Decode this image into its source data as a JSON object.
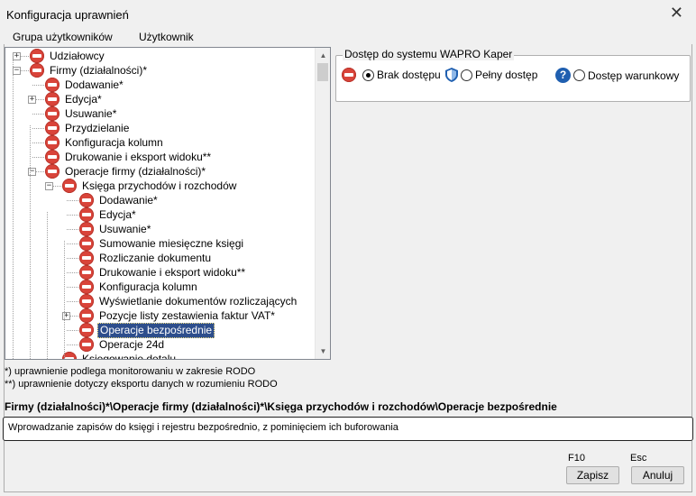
{
  "window": {
    "title": "Konfiguracja uprawnień",
    "close_glyph": "✕"
  },
  "tabs": [
    "Grupa użytkowników",
    "Użytkownik"
  ],
  "tree": {
    "items": [
      {
        "label": "Udziałowcy",
        "level": 0,
        "expander": "plus"
      },
      {
        "label": "Firmy (działalności)*",
        "level": 0,
        "expander": "minus"
      },
      {
        "label": "Dodawanie*",
        "level": 1
      },
      {
        "label": "Edycja*",
        "level": 1,
        "expander": "plus"
      },
      {
        "label": "Usuwanie*",
        "level": 1
      },
      {
        "label": "Przydzielanie",
        "level": 1
      },
      {
        "label": "Konfiguracja kolumn",
        "level": 1
      },
      {
        "label": "Drukowanie i eksport widoku**",
        "level": 1
      },
      {
        "label": "Operacje firmy (działalności)*",
        "level": 1,
        "expander": "minus"
      },
      {
        "label": "Księga przychodów i rozchodów",
        "level": 2,
        "expander": "minus"
      },
      {
        "label": "Dodawanie*",
        "level": 3
      },
      {
        "label": "Edycja*",
        "level": 3
      },
      {
        "label": "Usuwanie*",
        "level": 3
      },
      {
        "label": "Sumowanie miesięczne księgi",
        "level": 3
      },
      {
        "label": "Rozliczanie dokumentu",
        "level": 3
      },
      {
        "label": "Drukowanie i eksport widoku**",
        "level": 3
      },
      {
        "label": "Konfiguracja kolumn",
        "level": 3
      },
      {
        "label": "Wyświetlanie dokumentów rozliczających",
        "level": 3
      },
      {
        "label": "Pozycje listy zestawienia faktur VAT*",
        "level": 3,
        "expander": "plus"
      },
      {
        "label": "Operacje bezpośrednie",
        "level": 3,
        "selected": true
      },
      {
        "label": "Operacje 24d",
        "level": 3
      },
      {
        "label": "Księgowanie detalu",
        "level": 2
      }
    ],
    "scroll_up": "▲",
    "scroll_down": "▼"
  },
  "access": {
    "title": "Dostęp do systemu WAPRO Kaper",
    "options": [
      {
        "label": "Brak dostępu",
        "icon": "no-access-icon",
        "checked": true
      },
      {
        "label": "Pełny dostęp",
        "icon": "shield-icon",
        "checked": false
      },
      {
        "label": "Dostęp warunkowy",
        "icon": "help-icon",
        "checked": false
      }
    ],
    "help_glyph": "?"
  },
  "notes": [
    " *) uprawnienie podlega monitorowaniu w zakresie RODO",
    "**) uprawnienie dotyczy eksportu danych w rozumieniu RODO"
  ],
  "path": "Firmy (działalności)*\\Operacje firmy (działalności)*\\Księga przychodów i rozchodów\\Operacje bezpośrednie",
  "description": "Wprowadzanie zapisów do księgi i rejestru bezpośrednio, z pominięciem ich buforowania",
  "buttons": {
    "save": {
      "label": "Zapisz",
      "key": "F10"
    },
    "cancel": {
      "label": "Anuluj",
      "key": "Esc"
    }
  },
  "colors": {
    "no_access": "#d9443a",
    "selection": "#2d4e8c",
    "help": "#1f5fb0"
  }
}
